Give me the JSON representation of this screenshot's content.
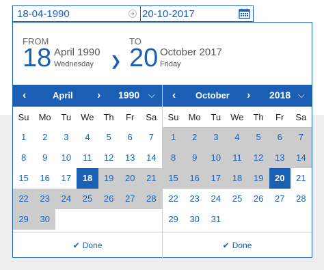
{
  "input": {
    "start": "18-04-1990",
    "end": "20-10-2017"
  },
  "summary": {
    "from_label": "FROM",
    "from_day": "18",
    "from_month_year": "April 1990",
    "from_weekday": "Wednesday",
    "to_label": "TO",
    "to_day": "20",
    "to_month_year": "October 2017",
    "to_weekday": "Friday"
  },
  "weekdays": [
    "Su",
    "Mo",
    "Tu",
    "We",
    "Th",
    "Fr",
    "Sa"
  ],
  "left_cal": {
    "month": "April",
    "year": "1990",
    "first_offset": 0,
    "days": 30,
    "selected": 18,
    "range_from": 19,
    "range_to": 30,
    "done_label": "Done"
  },
  "right_cal": {
    "month": "October",
    "year": "2018",
    "first_offset": 0,
    "days": 31,
    "selected": 20,
    "range_from": 1,
    "range_to": 19,
    "done_label": "Done"
  },
  "colors": {
    "accent": "#1a5fb4",
    "range": "#cccccc"
  }
}
